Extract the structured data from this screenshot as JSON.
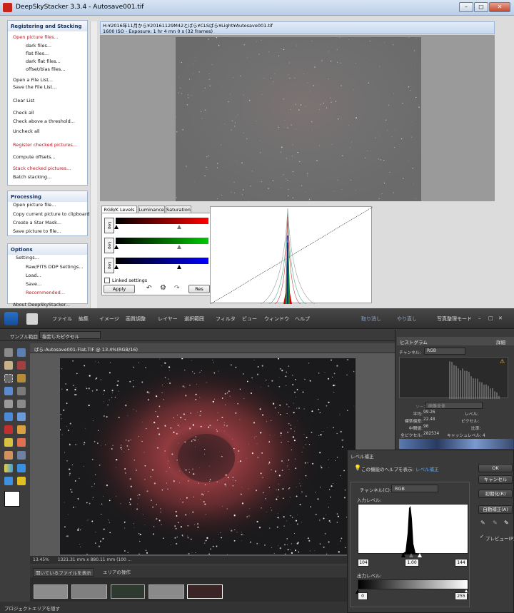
{
  "dss": {
    "title": "DeepSkyStacker 3.3.4 - Autosave001.tif",
    "file_path": "H:¥2016年11月から¥20161129M42とばら¥CLSばら¥Light¥Autosave001.tif",
    "exposure_info": "1600 ISO - Exposure: 1 hr 4 mn 0 s (32 frames)",
    "window_buttons": {
      "minimize": "–",
      "maximize": "□",
      "close": "✕"
    },
    "sidebar": {
      "registering": {
        "header": "Registering and Stacking",
        "items": [
          "Open picture files...",
          "dark files...",
          "flat files...",
          "dark flat files...",
          "offset/bias files...",
          "Open a File List...",
          "Save the File List...",
          "Clear List",
          "Check all",
          "Check above a threshold...",
          "Uncheck all",
          "Register checked pictures...",
          "Compute offsets...",
          "Stack checked pictures...",
          "Batch stacking..."
        ]
      },
      "processing": {
        "header": "Processing",
        "items": [
          "Open picture file...",
          "Copy current picture to clipboard",
          "Create a Star Mask...",
          "Save picture to file..."
        ]
      },
      "options": {
        "header": "Options",
        "items": [
          "Settings...",
          "Raw/FITS DDP Settings...",
          "Load...",
          "Save...",
          "Recommended..."
        ]
      },
      "about": "About DeepSkyStacker..."
    },
    "tabs": [
      "RGB/K Levels",
      "Luminance",
      "Saturation"
    ],
    "log_label": "Log",
    "linked_settings": "Linked settings",
    "apply": "Apply",
    "reset": "Res",
    "tool_icons": [
      "undo-icon",
      "gear-icon",
      "redo-icon"
    ]
  },
  "pse": {
    "menu": [
      "ファイル",
      "編集",
      "イメージ",
      "画質調整",
      "レイヤー",
      "選択範囲",
      "フィルタ",
      "ビュー",
      "ウィンドウ",
      "ヘルプ"
    ],
    "undo": "取り消し",
    "redo": "やり直し",
    "organizer": "写真整理モード",
    "option_label": "サンプル範囲",
    "option_value": "指定したピクセル",
    "doc_title": "ばら-Autosave001-Flat.TIF @ 13.4%(RGB/16)",
    "zoom": "13.45%",
    "dimensions": "1321.31 mm x 880.11 mm (100 ...",
    "bin_dropdown": "開いているファイルを表示",
    "bin_action": "エリアの操作",
    "footer": "プロジェクトエリアを隠す",
    "histogram": {
      "title": "ヒストグラム",
      "detail": "詳細",
      "channel_label": "チャンネル:",
      "channel_value": "RGB",
      "source_label": "ソース:",
      "source_value": "画像全体",
      "stats": [
        {
          "label": "平均:",
          "value": "99.26"
        },
        {
          "label": "標準偏差:",
          "value": "22.48"
        },
        {
          "label": "中間値:",
          "value": "96"
        },
        {
          "label": "全ピクセル:",
          "value": "282534"
        }
      ],
      "stats_right": [
        "レベル:",
        "ピクセル:",
        "比率:",
        "キャッシュレベル: 4"
      ]
    },
    "levels": {
      "title": "レベル補正",
      "help_text": "この機能のヘルプを表示:",
      "help_link": "レベル補正",
      "channel_label": "チャンネル(C):",
      "channel_value": "RGB",
      "input_label": "入力レベル:",
      "input_values": [
        "104",
        "1.00",
        "144"
      ],
      "output_label": "出力レベル:",
      "output_values": [
        "0",
        "255"
      ],
      "buttons": [
        "OK",
        "キャンセル",
        "初期化(R)",
        "自動補正(A)"
      ],
      "preview": "プレビュー(P)"
    }
  }
}
